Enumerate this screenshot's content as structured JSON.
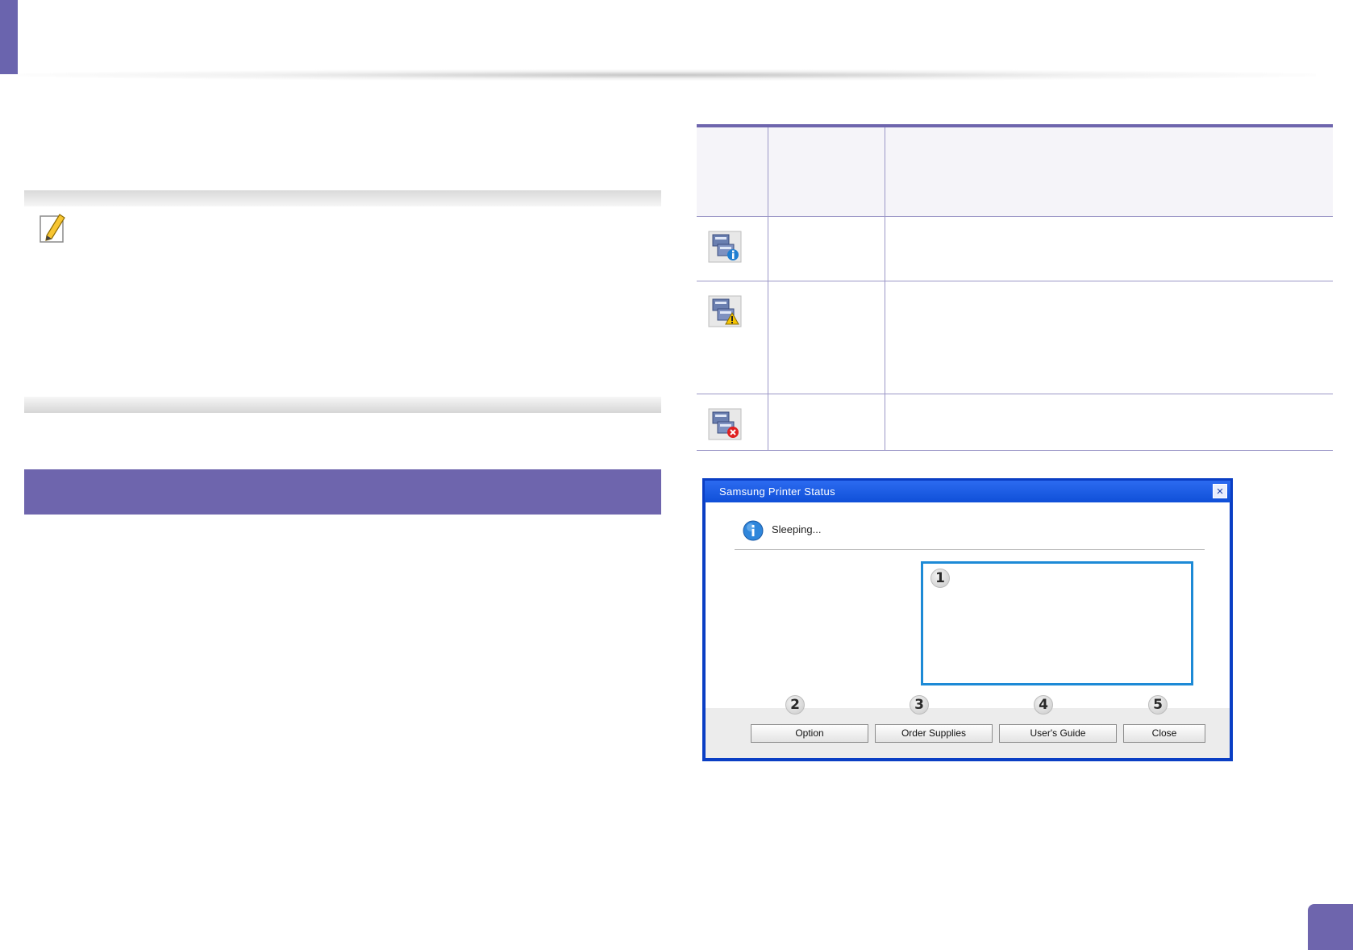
{
  "dialog": {
    "title": "Samsung Printer Status",
    "close_glyph": "×",
    "status_text": "Sleeping...",
    "buttons": {
      "option": "Option",
      "order_supplies": "Order Supplies",
      "users_guide": "User's Guide",
      "close": "Close"
    },
    "callouts": {
      "message_area": "1",
      "option": "2",
      "order_supplies": "3",
      "users_guide": "4",
      "close": "5"
    }
  },
  "table": {
    "rows": [
      {
        "icon": "printer-info-icon"
      },
      {
        "icon": "printer-warning-icon"
      },
      {
        "icon": "printer-error-icon"
      }
    ]
  },
  "icons": {
    "note": "note-pencil-icon",
    "status": "info-icon"
  },
  "colors": {
    "accent": "#6e65ad",
    "dialog_frame": "#0a3ec4",
    "message_border": "#1d8ad6"
  }
}
